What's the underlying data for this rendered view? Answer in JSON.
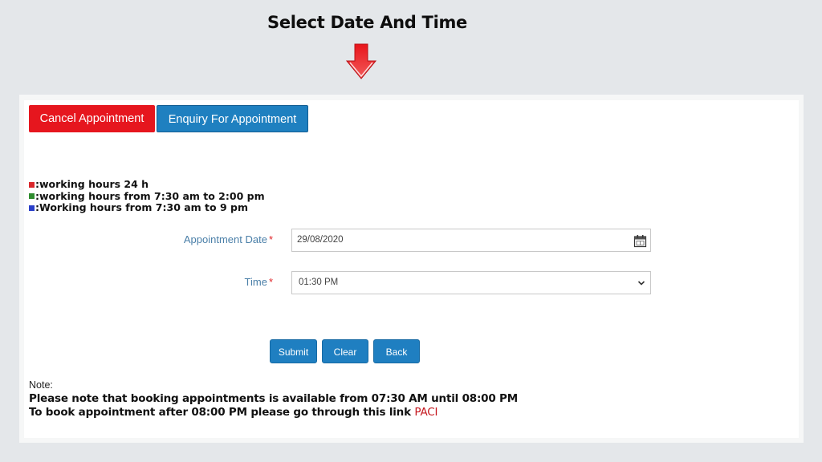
{
  "headline": "Select Date And Time",
  "tabs": {
    "cancel_label": "Cancel Appointment",
    "enquiry_label": "Enquiry For Appointment"
  },
  "legend": [
    {
      "color": "#d9262b",
      "text": ":working hours 24 h"
    },
    {
      "color": "#2e8b2e",
      "text": ":working hours from 7:30 am to 2:00 pm"
    },
    {
      "color": "#2a3fc9",
      "text": ":Working hours from 7:30 am to 9 pm"
    }
  ],
  "form": {
    "date_label": "Appointment Date",
    "date_value": "29/08/2020",
    "time_label": "Time",
    "time_value": "01:30 PM",
    "required_mark": "*"
  },
  "buttons": {
    "submit": "Submit",
    "clear": "Clear",
    "back": "Back"
  },
  "note": {
    "heading": "Note:",
    "line1": "Please note that booking appointments is available from 07:30 AM until 08:00 PM",
    "line2": "To book appointment after 08:00 PM please go through this link",
    "link": "PACI"
  },
  "colors": {
    "cancel": "#e6161e",
    "primary": "#1f80c0",
    "arrow": "#e8151b"
  }
}
